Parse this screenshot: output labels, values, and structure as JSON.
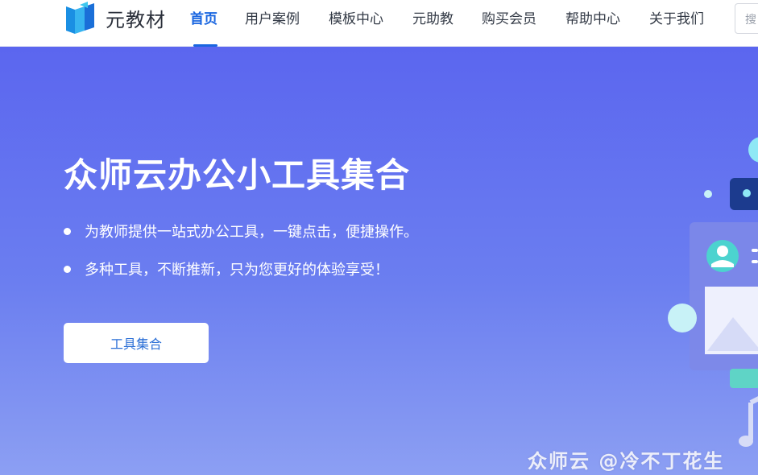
{
  "header": {
    "logo_text": "元教材",
    "nav": [
      {
        "label": "首页",
        "active": true
      },
      {
        "label": "用户案例",
        "active": false
      },
      {
        "label": "模板中心",
        "active": false
      },
      {
        "label": "元助教",
        "active": false
      },
      {
        "label": "购买会员",
        "active": false
      },
      {
        "label": "帮助中心",
        "active": false
      },
      {
        "label": "关于我们",
        "active": false
      }
    ],
    "search_placeholder": "搜"
  },
  "hero": {
    "title": "众师云办公小工具集合",
    "bullets": [
      "为教师提供一站式办公工具，一键点击，便捷操作。",
      "多种工具，不断推新，只为您更好的体验享受！"
    ],
    "cta_label": "工具集合"
  },
  "watermark": "众师云 @冷不丁花生",
  "colors": {
    "brand_blue": "#1a66e0",
    "logo_cyan": "#22a6e8",
    "hero_gradient_top": "#5b66ef",
    "hero_gradient_bottom": "#8c9ff3",
    "cta_text": "#2b6fd6"
  },
  "icons": {
    "logo": "book-logo-icon",
    "illustration": "profile-card-illustration",
    "music": "music-note-icon"
  }
}
